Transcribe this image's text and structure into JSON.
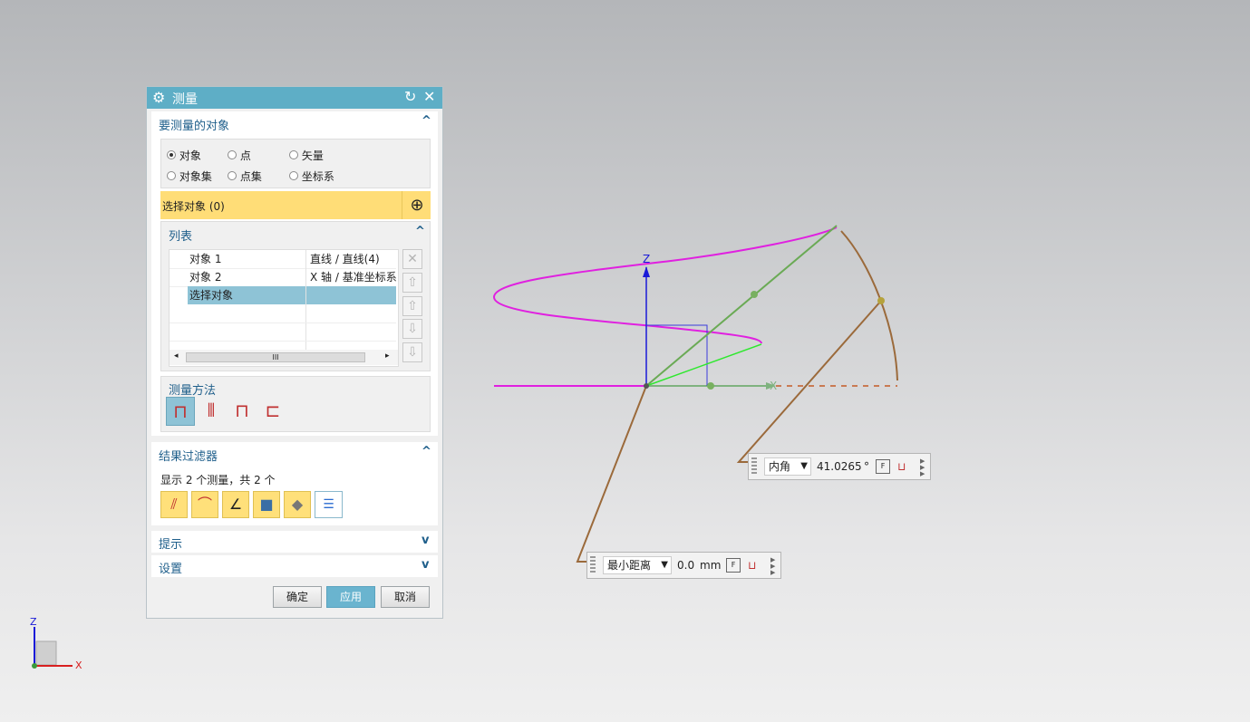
{
  "dialog": {
    "title": "测量",
    "reset_icon": "reset-icon",
    "close_icon": "close-icon",
    "section_objects": {
      "title": "要测量的对象",
      "radios": [
        {
          "label": "对象",
          "selected": true
        },
        {
          "label": "点",
          "selected": false
        },
        {
          "label": "矢量",
          "selected": false
        },
        {
          "label": "对象集",
          "selected": false
        },
        {
          "label": "点集",
          "selected": false
        },
        {
          "label": "坐标系",
          "selected": false
        }
      ],
      "select_label": "选择对象 (0)"
    },
    "list": {
      "title": "列表",
      "rows": [
        {
          "name": "对象 1",
          "type": "直线 / 直线(4)"
        },
        {
          "name": "对象 2",
          "type": "X 轴 / 基准坐标系"
        },
        {
          "name": "选择对象",
          "type": ""
        }
      ],
      "scroll_grip": "III"
    },
    "method": {
      "title": "测量方法"
    },
    "filter": {
      "title": "结果过滤器",
      "summary": "显示 2 个测量，共 2 个"
    },
    "hint": {
      "title": "提示"
    },
    "settings": {
      "title": "设置"
    },
    "buttons": {
      "ok": "确定",
      "apply": "应用",
      "cancel": "取消"
    }
  },
  "viewport": {
    "axis_z": "Z",
    "axis_x": "X",
    "readout_angle": {
      "type": "内角",
      "value": "41.0265",
      "unit": "°"
    },
    "readout_distance": {
      "type": "最小距离",
      "value": "0.0",
      "unit": "mm"
    },
    "triad": {
      "z": "Z",
      "x": "X"
    }
  },
  "colors": {
    "title_bar": "#5eaec6",
    "highlight": "#ffdd77",
    "selected_row": "#8ec3d6",
    "curve": "#e020e0"
  }
}
